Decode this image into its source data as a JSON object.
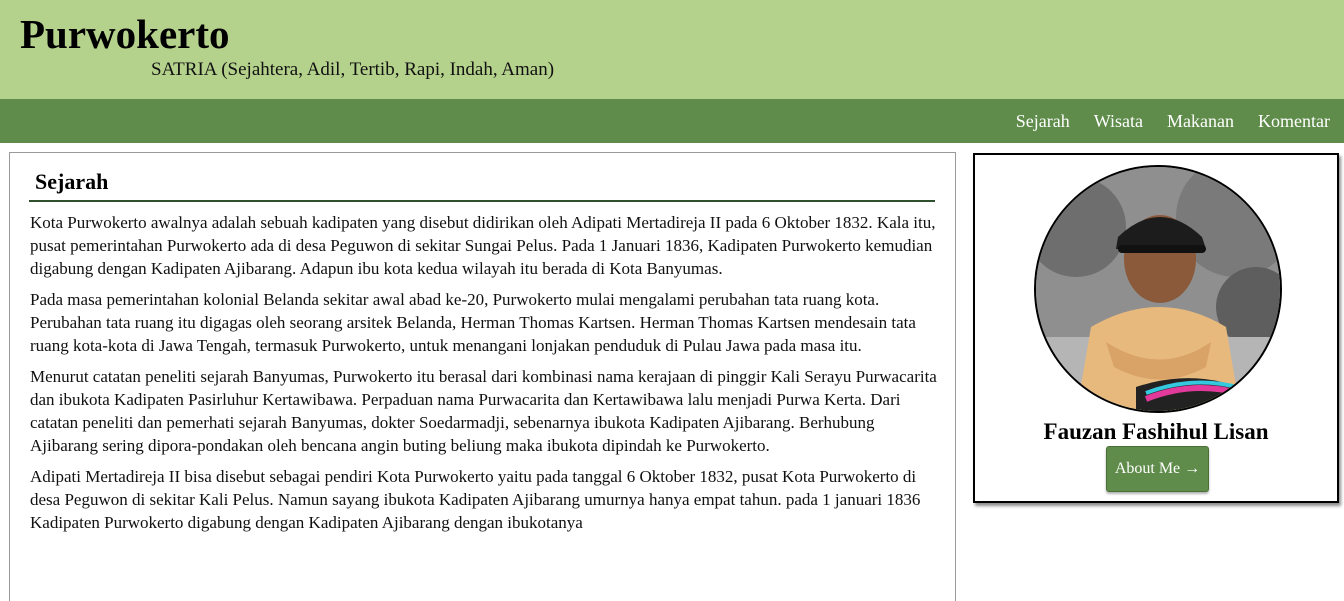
{
  "header": {
    "title": "Purwokerto",
    "tagline": "SATRIA (Sejahtera, Adil, Tertib, Rapi, Indah, Aman)"
  },
  "nav": {
    "items": [
      {
        "label": "Sejarah"
      },
      {
        "label": "Wisata"
      },
      {
        "label": "Makanan"
      },
      {
        "label": "Komentar"
      }
    ]
  },
  "main": {
    "heading": "Sejarah",
    "paragraphs": [
      "Kota Purwokerto awalnya adalah sebuah kadipaten yang disebut didirikan oleh Adipati Mertadireja II pada 6 Oktober 1832. Kala itu, pusat pemerintahan Purwokerto ada di desa Peguwon di sekitar Sungai Pelus. Pada 1 Januari 1836, Kadipaten Purwokerto kemudian digabung dengan Kadipaten Ajibarang. Adapun ibu kota kedua wilayah itu berada di Kota Banyumas.",
      "Pada masa pemerintahan kolonial Belanda sekitar awal abad ke-20, Purwokerto mulai mengalami perubahan tata ruang kota. Perubahan tata ruang itu digagas oleh seorang arsitek Belanda, Herman Thomas Kartsen. Herman Thomas Kartsen mendesain tata ruang kota-kota di Jawa Tengah, termasuk Purwokerto, untuk menangani lonjakan penduduk di Pulau Jawa pada masa itu.",
      "Menurut catatan peneliti sejarah Banyumas, Purwokerto itu berasal dari kombinasi nama kerajaan di pinggir Kali Serayu Purwacarita dan ibukota Kadipaten Pasirluhur Kertawibawa. Perpaduan nama Purwacarita dan Kertawibawa lalu menjadi Purwa Kerta. Dari catatan peneliti dan pemerhati sejarah Banyumas, dokter Soedarmadji, sebenarnya ibukota Kadipaten Ajibarang. Berhubung Ajibarang sering dipora-pondakan oleh bencana angin buting beliung maka ibukota dipindah ke Purwokerto.",
      "Adipati Mertadireja II bisa disebut sebagai pendiri Kota Purwokerto yaitu pada tanggal 6 Oktober 1832, pusat Kota Purwokerto di desa Peguwon di sekitar Kali Pelus. Namun sayang ibukota Kadipaten Ajibarang umurnya hanya empat tahun. pada 1 januari 1836 Kadipaten Purwokerto digabung dengan Kadipaten Ajibarang dengan ibukotanya"
    ]
  },
  "profile": {
    "name": "Fauzan Fashihul Lisan",
    "button_label": "About Me →"
  },
  "colors": {
    "header_bg": "#b5d28d",
    "nav_bg": "#5f8c4b",
    "button_bg": "#5f8c4b",
    "heading_rule": "#2f4f2f"
  }
}
